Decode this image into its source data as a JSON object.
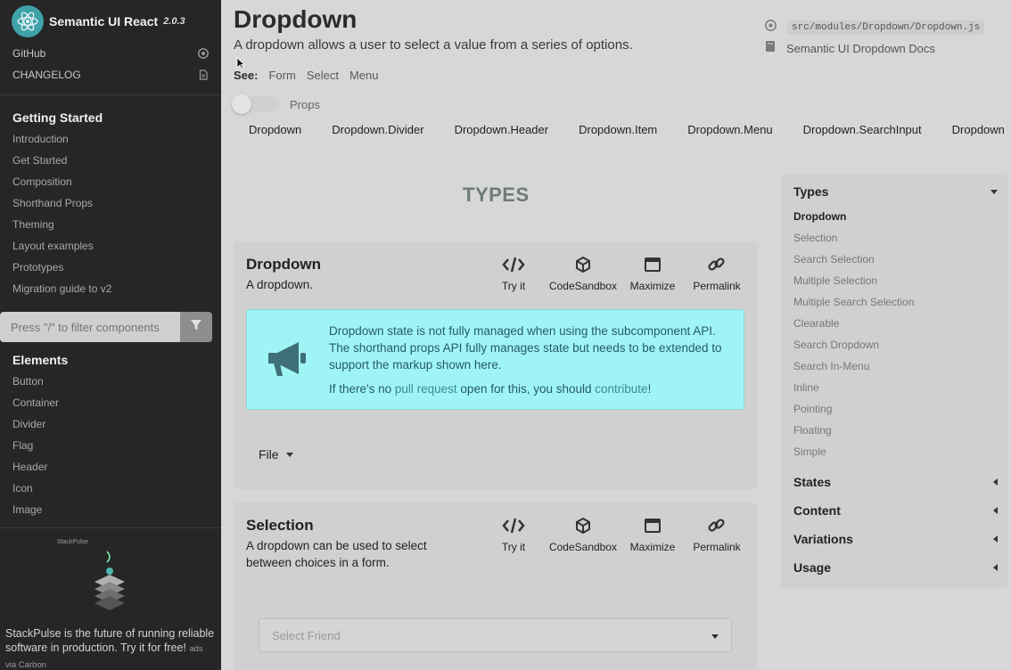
{
  "sidebar": {
    "brand": "Semantic UI React",
    "version": "2.0.3",
    "top_links": [
      {
        "label": "GitHub",
        "icon": "github-icon"
      },
      {
        "label": "CHANGELOG",
        "icon": "file-icon"
      }
    ],
    "getting_started": {
      "heading": "Getting Started",
      "items": [
        "Introduction",
        "Get Started",
        "Composition",
        "Shorthand Props",
        "Theming",
        "Layout examples",
        "Prototypes",
        "Migration guide to v2"
      ]
    },
    "filter_placeholder": "Press \"/\" to filter components",
    "elements": {
      "heading": "Elements",
      "items": [
        "Button",
        "Container",
        "Divider",
        "Flag",
        "Header",
        "Icon",
        "Image"
      ]
    },
    "ad": {
      "brand": "StackPulse",
      "text": "StackPulse is the future of running reliable software in production. Try it for free!",
      "via": "ads via Carbon"
    }
  },
  "header": {
    "title": "Dropdown",
    "subtitle": "A dropdown allows a user to select a value from a series of options.",
    "see_label": "See:",
    "see_links": [
      "Form",
      "Select",
      "Menu"
    ],
    "props_label": "Props",
    "subcomponents": [
      "Dropdown",
      "Dropdown.Divider",
      "Dropdown.Header",
      "Dropdown.Item",
      "Dropdown.Menu",
      "Dropdown.SearchInput",
      "Dropdown"
    ],
    "source_path": "src/modules/Dropdown/Dropdown.js",
    "docs_link": "Semantic UI Dropdown Docs"
  },
  "section_title": "TYPES",
  "actions": [
    "Try it",
    "CodeSandbox",
    "Maximize",
    "Permalink"
  ],
  "examples": [
    {
      "title": "Dropdown",
      "description": "A dropdown.",
      "notice_line1": "Dropdown state is not fully managed when using the subcomponent API. The shorthand props API fully manages state but needs to be extended to support the markup shown here.",
      "notice_pre": "If there's no ",
      "notice_link1": "pull request",
      "notice_mid": " open for this, you should ",
      "notice_link2": "contribute",
      "notice_end": "!",
      "demo_label": "File"
    },
    {
      "title": "Selection",
      "description": "A dropdown can be used to select between choices in a form.",
      "select_placeholder": "Select Friend"
    }
  ],
  "toc": {
    "types": {
      "heading": "Types",
      "items": [
        "Dropdown",
        "Selection",
        "Search Selection",
        "Multiple Selection",
        "Multiple Search Selection",
        "Clearable",
        "Search Dropdown",
        "Search In-Menu",
        "Inline",
        "Pointing",
        "Floating",
        "Simple"
      ],
      "active": "Dropdown"
    },
    "collapsed": [
      "States",
      "Content",
      "Variations",
      "Usage"
    ]
  },
  "colors": {
    "sidebar_bg": "#262626",
    "notice_bg": "#9ff5f5",
    "brand_teal": "#3fa2a8"
  }
}
